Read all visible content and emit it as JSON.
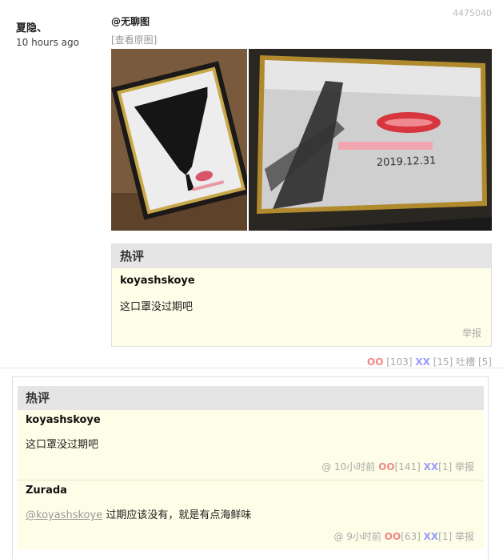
{
  "post": {
    "id": "4475040",
    "author": "夏隐、",
    "time": "10 hours ago",
    "mention": "@无聊图",
    "view_original": "[查看原图]"
  },
  "hot_box": {
    "title": "热评",
    "comment": {
      "user": "koyashskoye",
      "text": "这口罩没过期吧",
      "report": "举报"
    }
  },
  "votes": {
    "oo_label": "OO",
    "oo_count": "[103]",
    "xx_label": "XX",
    "xx_count": "[15]",
    "tucao": "吐槽 [5]"
  },
  "lower": {
    "title": "热评",
    "comments": [
      {
        "user": "koyashskoye",
        "text": "这口罩没过期吧",
        "at": "@",
        "time": "10小时前",
        "oo_label": "OO",
        "oo_count": "[141]",
        "xx_label": "XX",
        "xx_count": "[1]",
        "report": "举报"
      },
      {
        "user": "Zurada",
        "mention": "@koyashskoye",
        "text": "过期应该没有，就是有点海鲜味",
        "at": "@",
        "time": "9小时前",
        "oo_label": "OO",
        "oo_count": "[63]",
        "xx_label": "XX",
        "xx_count": "[1]",
        "report": "举报"
      }
    ]
  },
  "colors": {
    "oo": "#ee8888",
    "xx": "#9999ff",
    "hot_bg": "#fefee8",
    "hot_title_bg": "#e5e5e5"
  }
}
